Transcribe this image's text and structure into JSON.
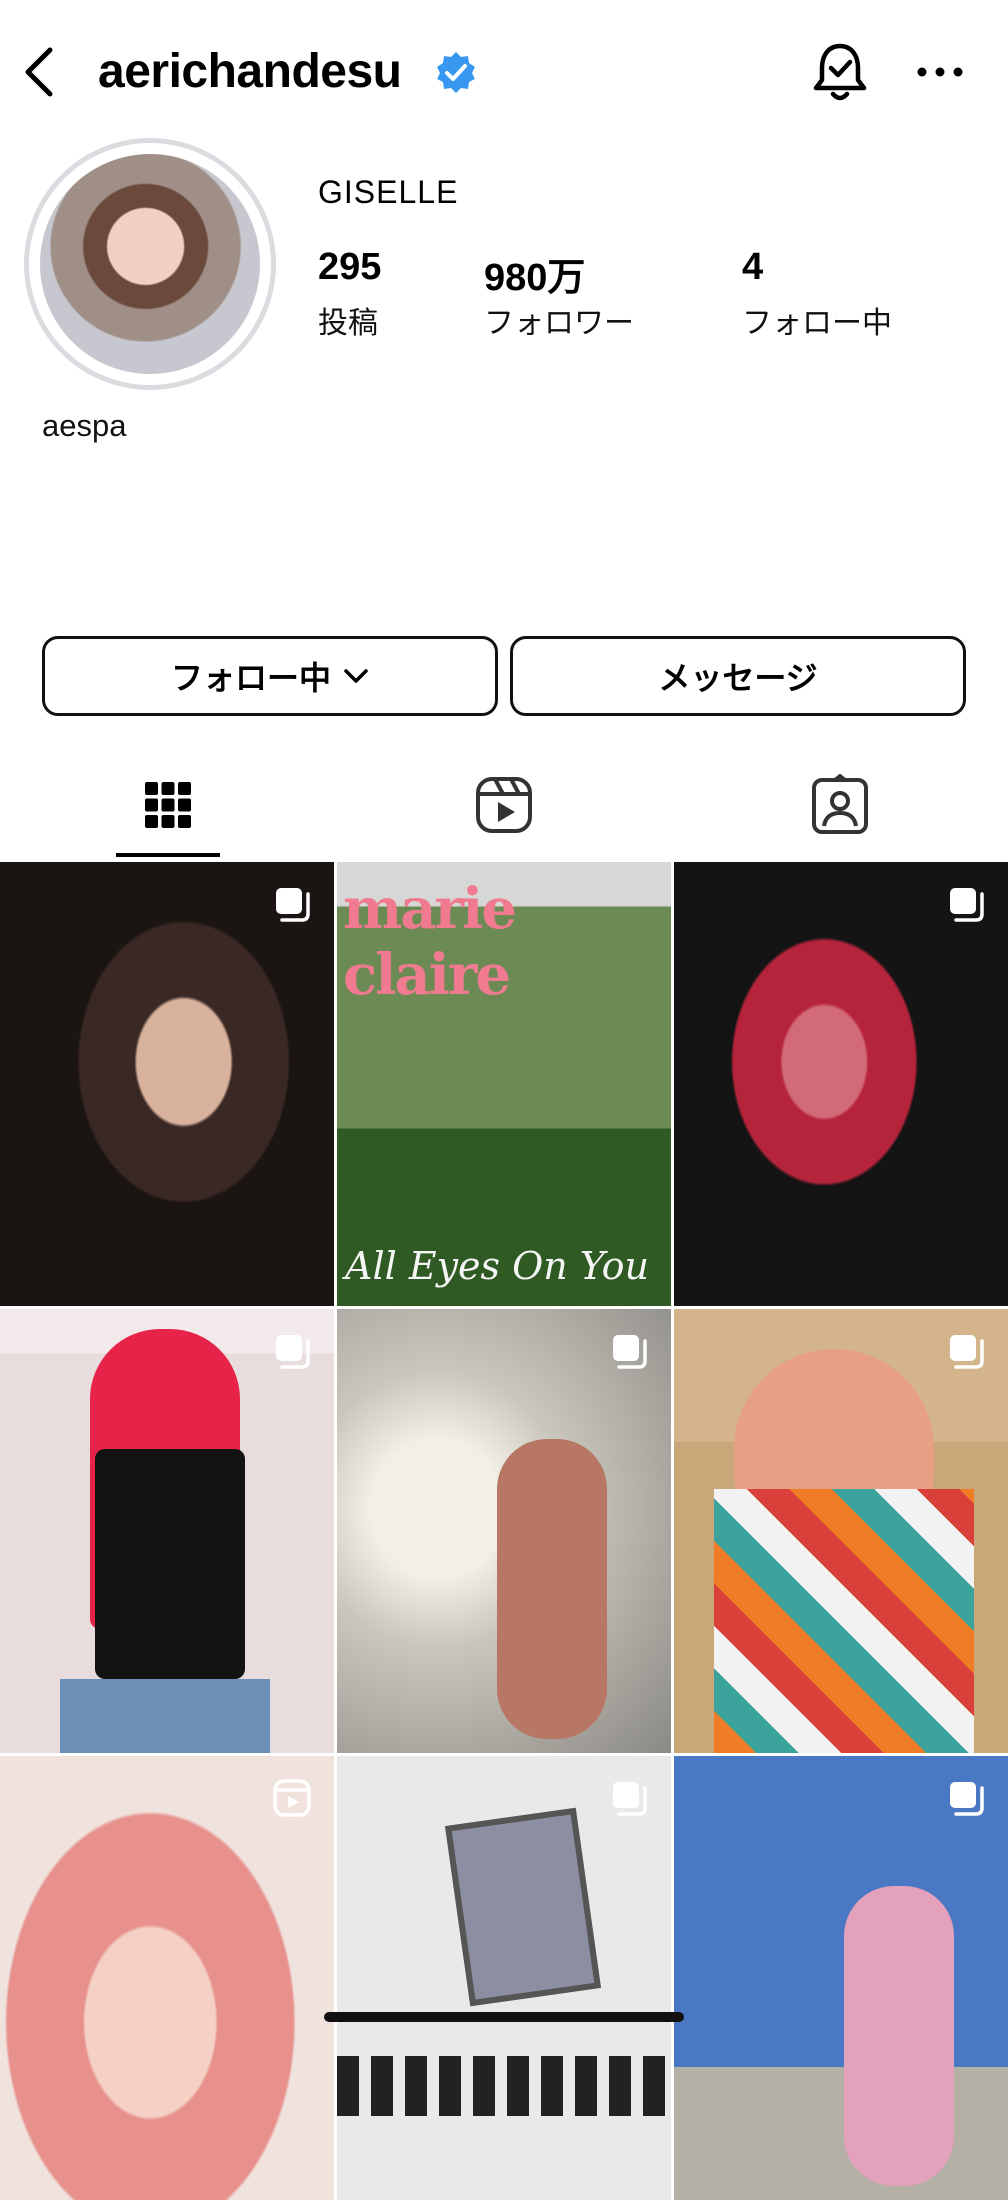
{
  "header": {
    "username": "aerichandesu",
    "back_icon": "chevron-left-icon",
    "verified_icon": "verified-badge-icon",
    "bell_icon": "notification-bell-icon",
    "more_icon": "more-horizontal-icon"
  },
  "profile": {
    "display_name": "GISELLE",
    "bio": "aespa",
    "stats": [
      {
        "value": "295",
        "label": "投稿"
      },
      {
        "value": "980万",
        "label": "フォロワー"
      },
      {
        "value": "4",
        "label": "フォロー中"
      }
    ]
  },
  "actions": {
    "follow_label": "フォロー中",
    "message_label": "メッセージ"
  },
  "tabs": [
    {
      "icon": "grid-icon",
      "active": true
    },
    {
      "icon": "reels-icon",
      "active": false
    },
    {
      "icon": "tagged-icon",
      "active": false
    }
  ],
  "grid": {
    "magazine_title": "marie claire",
    "magazine_caption": "All Eyes On You"
  },
  "colors": {
    "verified_blue": "#3897f0",
    "border": "#dbdbe0",
    "magazine_pink": "#f07b90"
  }
}
